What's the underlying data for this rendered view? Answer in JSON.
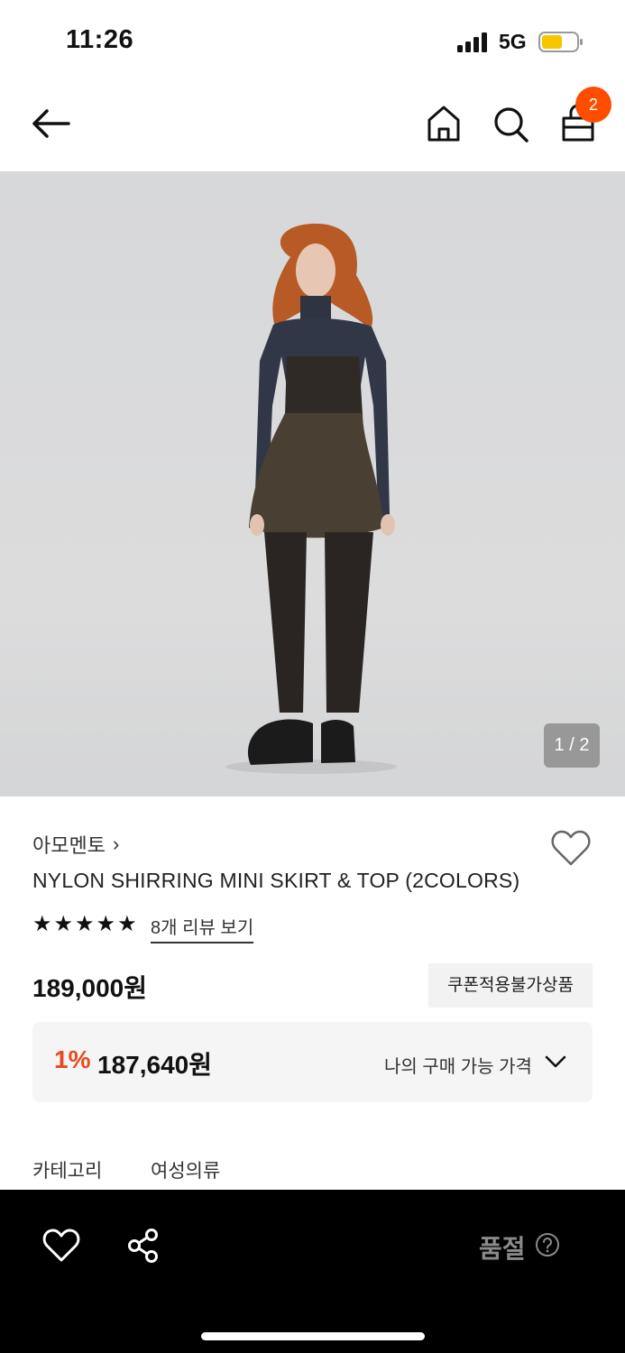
{
  "status_bar": {
    "time": "11:26",
    "network": "5G"
  },
  "header": {
    "cart_count": "2"
  },
  "image_viewer": {
    "counter": "1 / 2"
  },
  "product": {
    "brand": "아모멘토",
    "brand_chevron": "›",
    "title": "NYLON SHIRRING MINI SKIRT & TOP (2COLORS)",
    "rating_stars": 5,
    "review_link": "8개 리뷰 보기",
    "price": "189,000원",
    "coupon_badge": "쿠폰적용불가상품",
    "benefit_percent": "1%",
    "benefit_price": "187,640원",
    "benefit_label": "나의 구매 가능 가격",
    "category_label": "카테고리",
    "category_value": "여성의류"
  },
  "bottom_bar": {
    "soldout_label": "품절"
  },
  "icons": [
    "back-arrow-icon",
    "home-icon",
    "search-icon",
    "shopping-bag-icon",
    "heart-icon",
    "share-icon",
    "chevron-down-icon",
    "help-circle-icon"
  ],
  "colors": {
    "accent": "#ff4d00",
    "discount": "#e8491d",
    "bottom_bar": "#000000",
    "soldout_text": "#8a8a8a"
  }
}
